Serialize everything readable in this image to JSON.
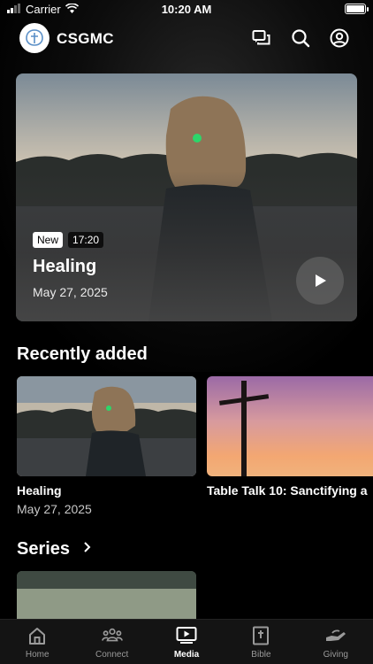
{
  "status_bar": {
    "carrier": "Carrier",
    "time": "10:20 AM"
  },
  "header": {
    "app_name": "CSGMC"
  },
  "featured": {
    "badge": "New",
    "duration": "17:20",
    "title": "Healing",
    "date": "May 27, 2025"
  },
  "recently_added": {
    "title": "Recently added",
    "items": [
      {
        "title": "Healing",
        "date": "May 27, 2025"
      },
      {
        "title": "Table Talk 10: Sanctifying a"
      }
    ]
  },
  "series": {
    "title": "Series"
  },
  "tab_bar": {
    "items": [
      {
        "label": "Home",
        "icon": "home-icon"
      },
      {
        "label": "Connect",
        "icon": "people-icon"
      },
      {
        "label": "Media",
        "icon": "tv-play-icon"
      },
      {
        "label": "Bible",
        "icon": "bible-icon"
      },
      {
        "label": "Giving",
        "icon": "giving-hand-icon"
      }
    ],
    "active": "Media"
  },
  "colors": {
    "background": "#000000",
    "tab_bar": "#141414",
    "inactive_tab": "#9a9a9a"
  }
}
